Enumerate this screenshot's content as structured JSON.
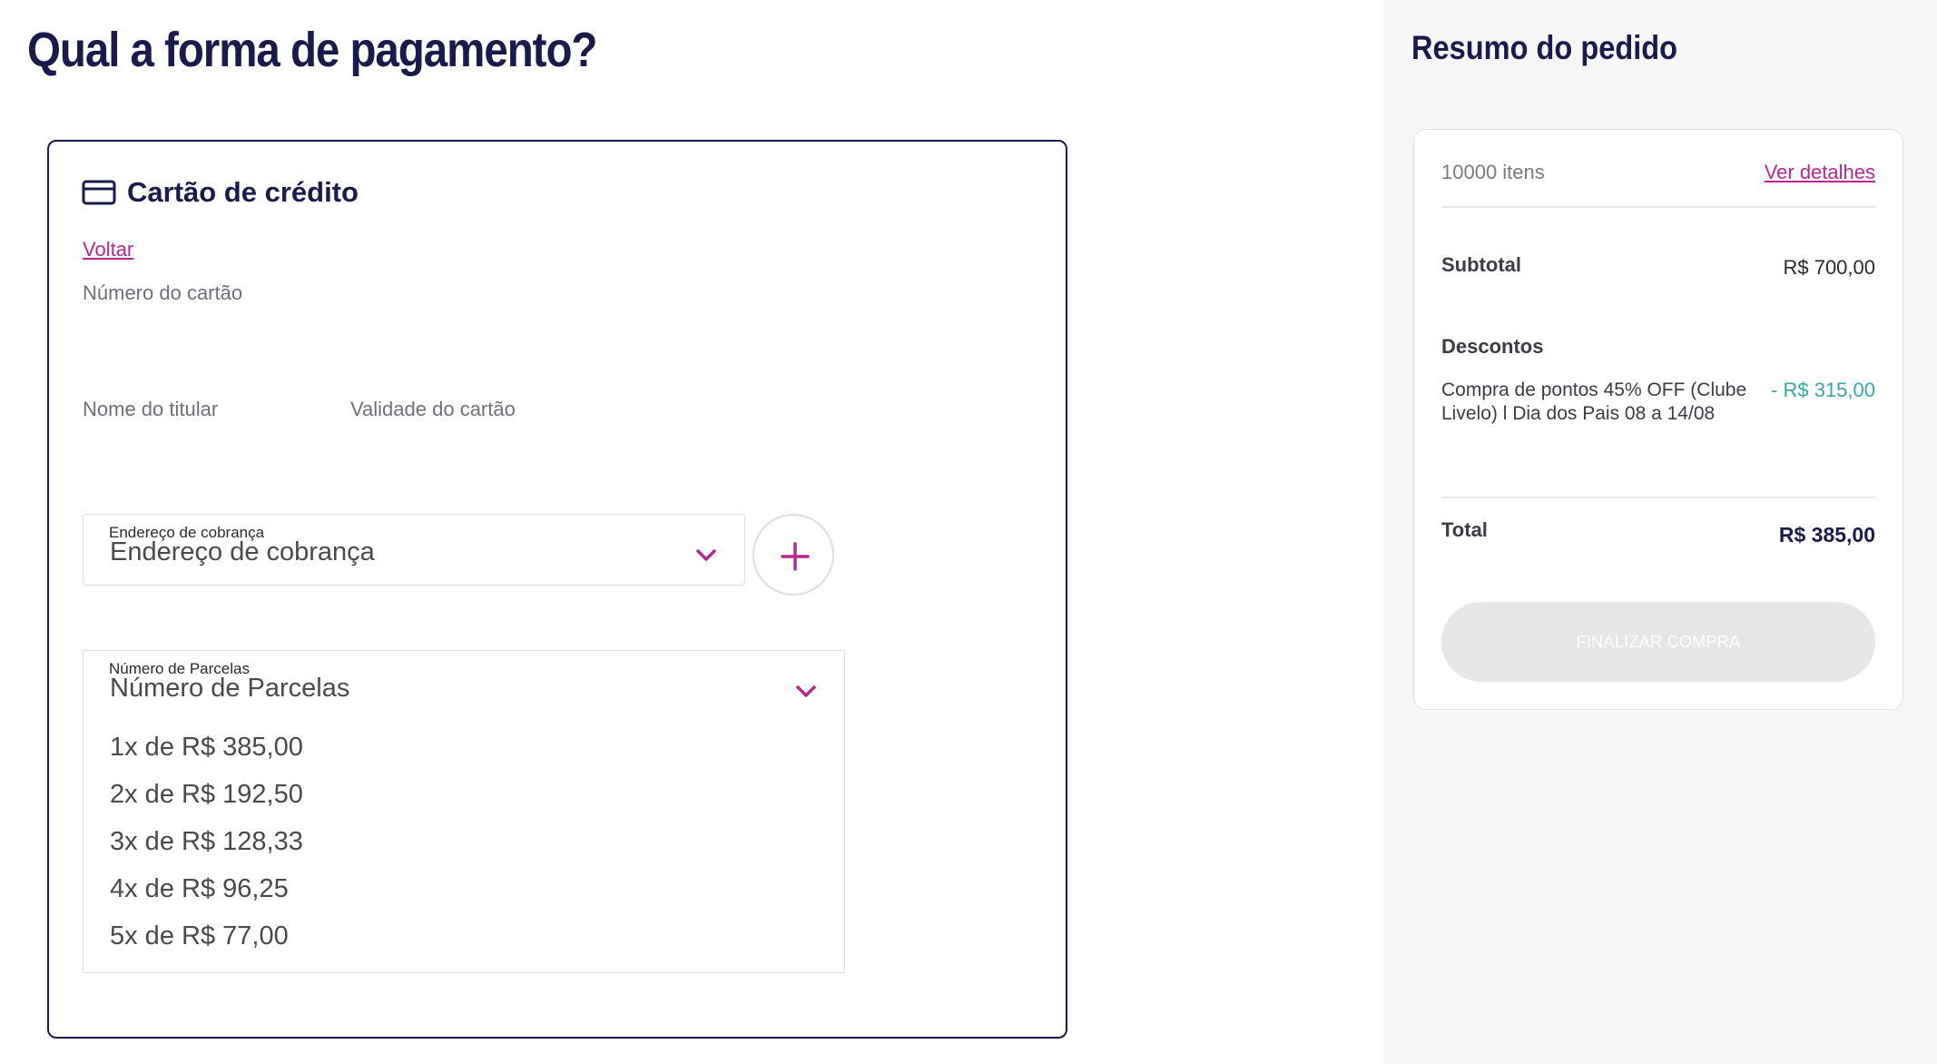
{
  "page": {
    "title": "Qual a forma de pagamento?"
  },
  "payment": {
    "method_title": "Cartão de crédito",
    "method_icon": "credit-card-icon",
    "back_label": "Voltar",
    "card_number_label": "Número do cartão",
    "holder_name_label": "Nome do titular",
    "validity_label": "Validade do cartão",
    "billing_address": {
      "small_label": "Endereço de cobrança",
      "value": "Endereço de cobrança"
    },
    "add_address_icon": "plus-icon",
    "installments": {
      "small_label": "Número de Parcelas",
      "value": "Número de Parcelas",
      "options": [
        "1x de R$ 385,00",
        "2x de R$ 192,50",
        "3x de R$ 128,33",
        "4x de R$ 96,25",
        "5x de R$ 77,00"
      ]
    }
  },
  "summary": {
    "title": "Resumo do pedido",
    "items_count": "10000 itens",
    "details_link": "Ver detalhes",
    "subtotal_label": "Subtotal",
    "subtotal_value": "R$ 700,00",
    "discounts_label": "Descontos",
    "discount_description": "Compra de pontos 45% OFF (Clube Livelo) l Dia dos Pais 08 a 14/08",
    "discount_value": "- R$ 315,00",
    "total_label": "Total",
    "total_value": "R$ 385,00",
    "finish_button": "FINALIZAR COMPRA"
  },
  "colors": {
    "navy": "#1b1b4b",
    "accent_pink": "#b8288e",
    "discount_teal": "#3aa6a6",
    "disabled_button": "#e7e7e9",
    "sidebar_bg": "#f6f6f6"
  }
}
